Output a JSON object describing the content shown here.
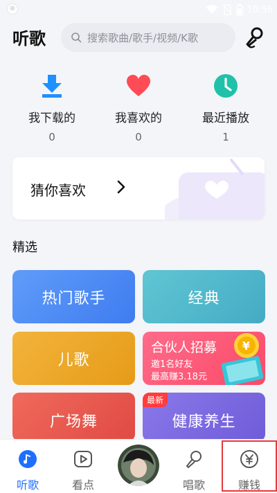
{
  "status_bar": {
    "time": "10:56",
    "icons": [
      "app-notification-icon",
      "wifi-icon",
      "no-sim-icon",
      "battery-icon"
    ]
  },
  "header": {
    "title": "听歌",
    "search_placeholder": "搜索歌曲/歌手/视频/K歌",
    "icons": [
      "search-icon",
      "microphone-icon"
    ]
  },
  "quick_access": [
    {
      "label": "我下载的",
      "count": "0",
      "icon": "download-icon",
      "color": "#1e90ff"
    },
    {
      "label": "我喜欢的",
      "count": "0",
      "icon": "heart-icon",
      "color": "#ff4b55"
    },
    {
      "label": "最近播放",
      "count": "1",
      "icon": "clock-icon",
      "color": "#20c1a8"
    }
  ],
  "guess_card": {
    "label": "猜你喜欢",
    "icon": "chevron-right-icon"
  },
  "section": {
    "title": "精选"
  },
  "tiles": {
    "hot_singers": "热门歌手",
    "classic": "经典",
    "kids": "儿歌",
    "square_dance": "广场舞",
    "health": "健康养生",
    "new_badge": "最新",
    "partner": {
      "title": "合伙人招募",
      "line1": "邀1名好友",
      "line2": "最高赚3.18元",
      "coin_symbol": "¥"
    }
  },
  "bottom_nav": {
    "items": [
      {
        "label": "听歌",
        "icon": "music-note-icon",
        "active": true
      },
      {
        "label": "看点",
        "icon": "play-video-icon",
        "active": false
      },
      {
        "label": "唱歌",
        "icon": "microphone-icon",
        "active": false
      },
      {
        "label": "赚钱",
        "icon": "yuan-coin-icon",
        "active": false
      }
    ]
  },
  "colors": {
    "accent": "#1f6fff",
    "background": "#f4f5f9",
    "highlight": "#e23a3a"
  }
}
